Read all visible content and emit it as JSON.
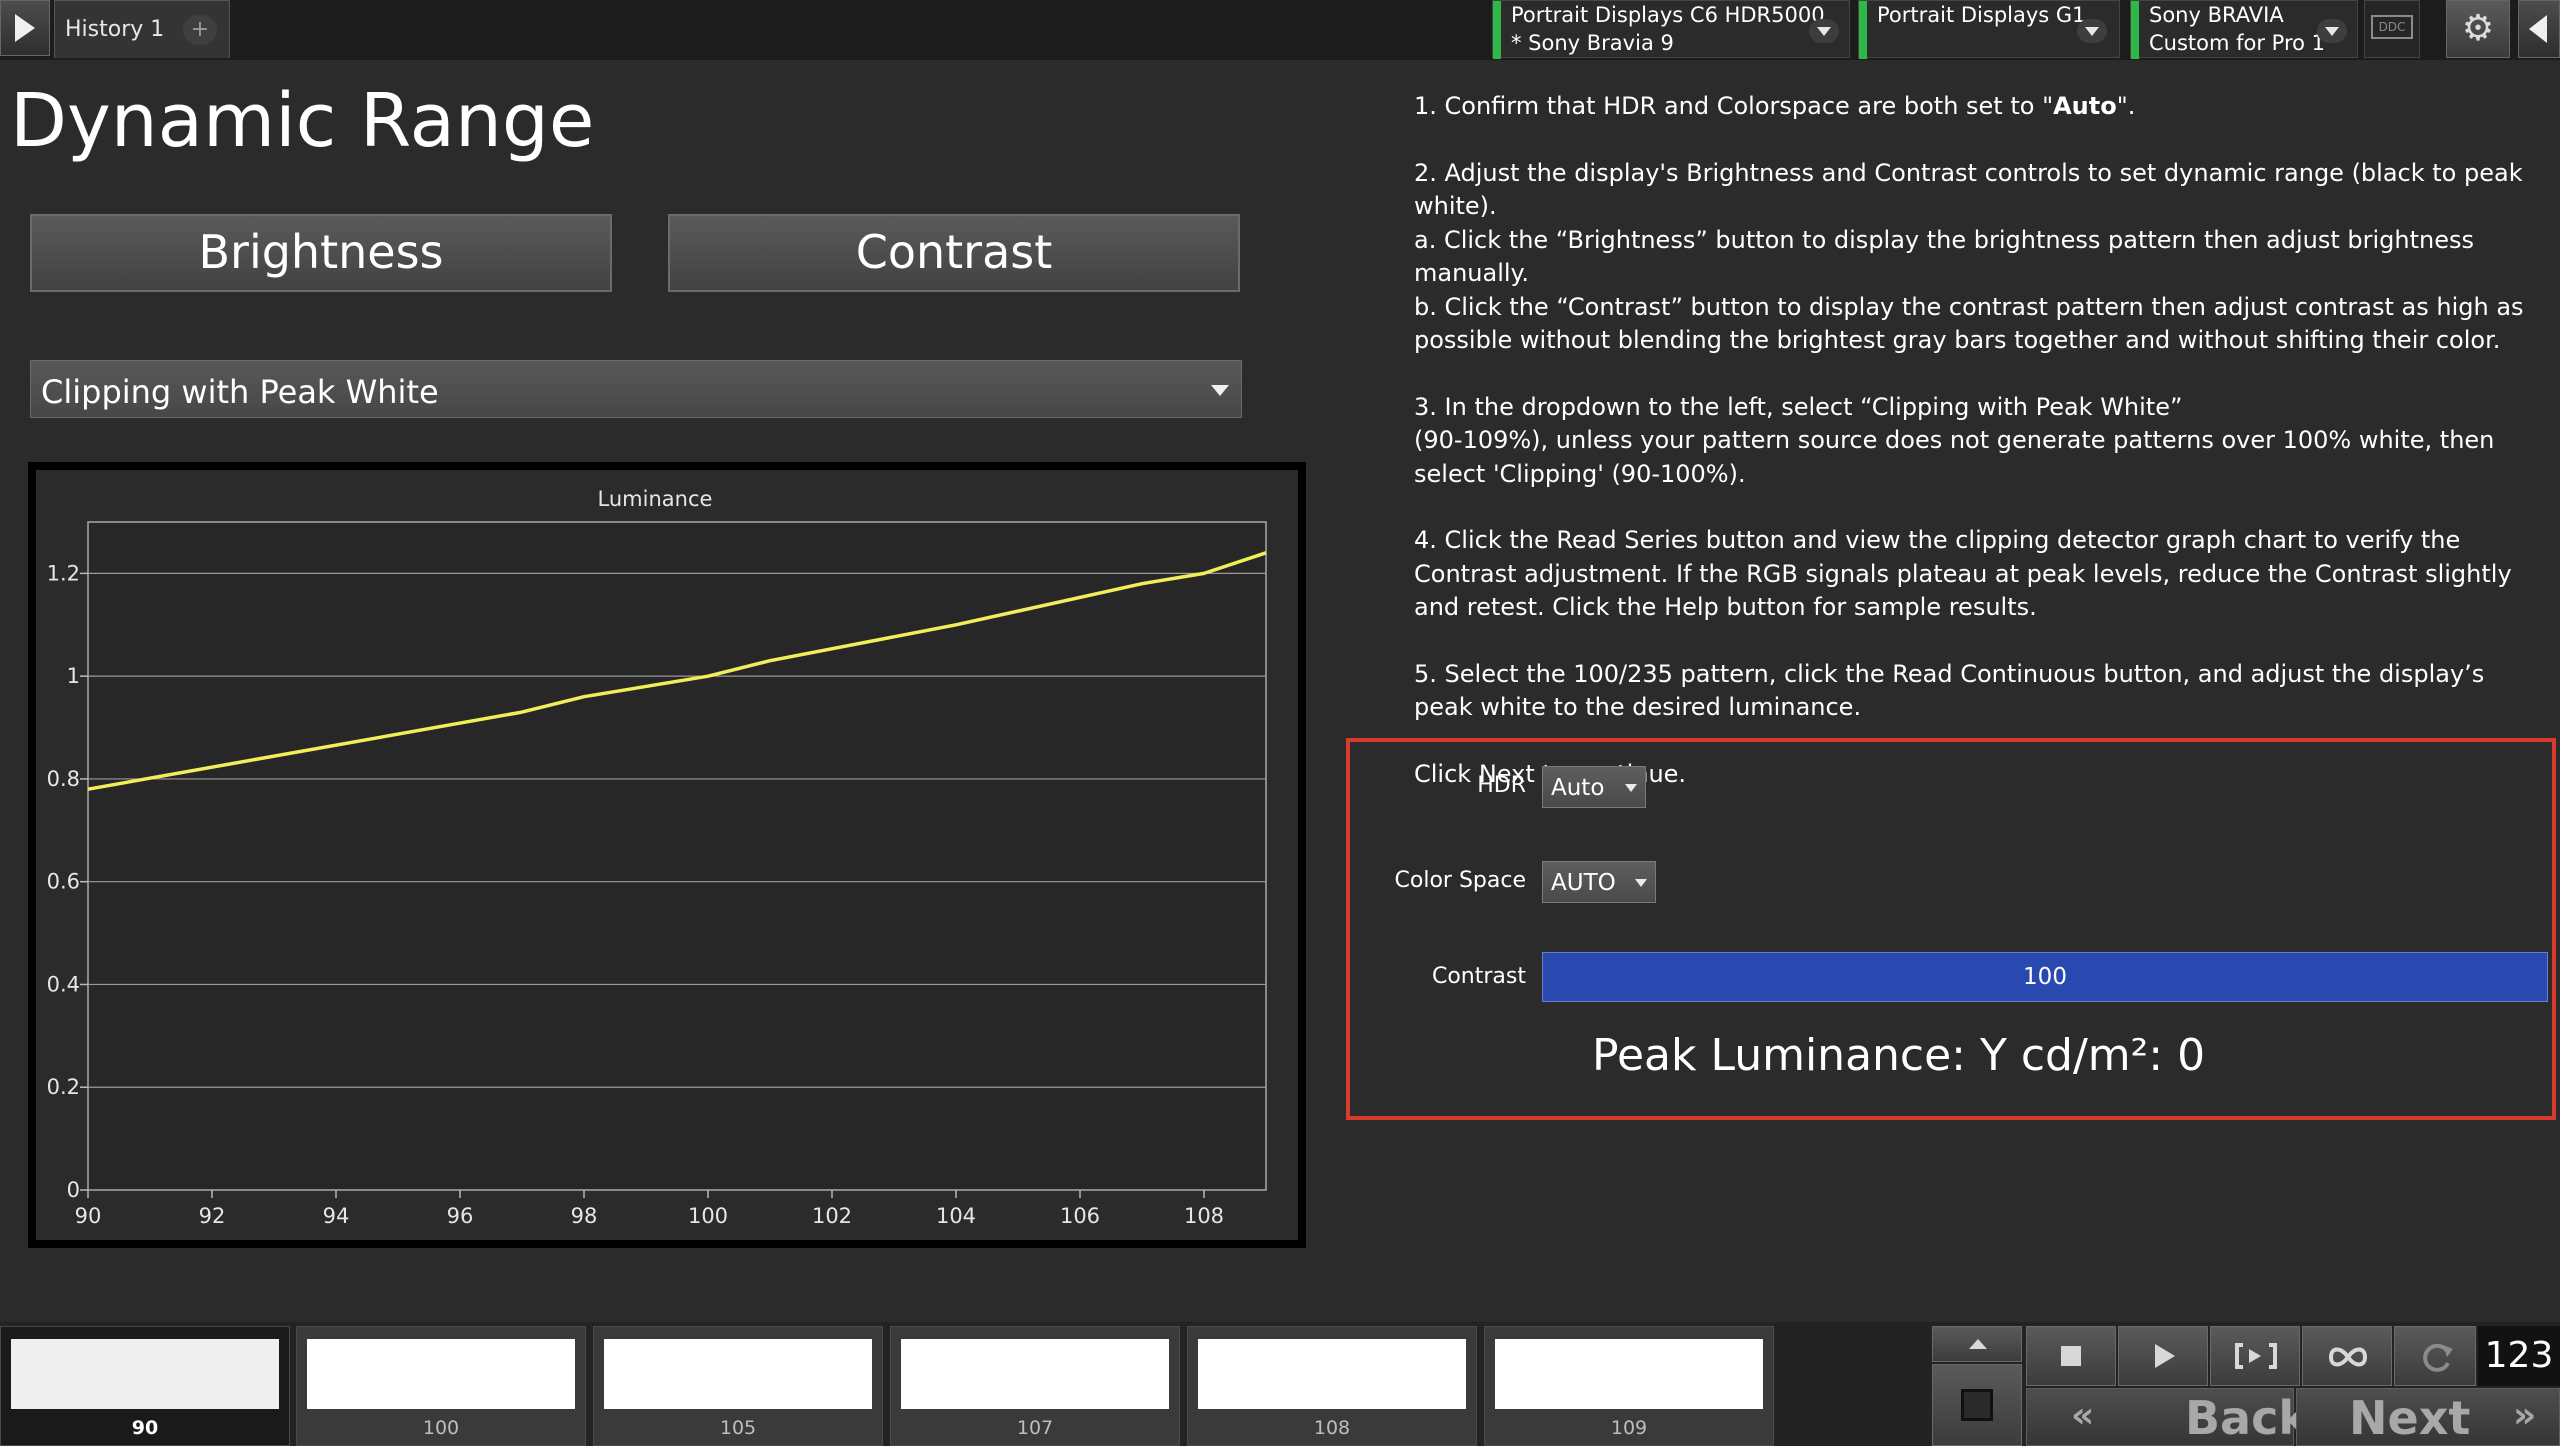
{
  "topbar": {
    "history_tab": "History 1",
    "add_tab": "+",
    "devices": [
      {
        "line1": "Portrait Displays C6 HDR5000",
        "line2": "* Sony Bravia 9"
      },
      {
        "line1": "Portrait Displays G1",
        "line2": ""
      },
      {
        "line1": "Sony BRAVIA",
        "line2": "Custom for Pro 1"
      }
    ],
    "ddc_label": "DDC",
    "status_color": "#2fb84a"
  },
  "page": {
    "title": "Dynamic Range",
    "brightness_label": "Brightness",
    "contrast_label": "Contrast",
    "pattern_selected": "Clipping with Peak White"
  },
  "chart_data": {
    "type": "line",
    "title": "Luminance",
    "xlabel": "",
    "ylabel": "",
    "xlim": [
      90,
      109
    ],
    "ylim": [
      0,
      1.3
    ],
    "x_ticks": [
      90,
      92,
      94,
      96,
      98,
      100,
      102,
      104,
      106,
      108
    ],
    "y_ticks": [
      0,
      0.2,
      0.4,
      0.6,
      0.8,
      1,
      1.2
    ],
    "y_tick_labels": [
      "0",
      "0.2",
      "0.4",
      "0.6",
      "0.8",
      "1",
      "1.2"
    ],
    "grid": true,
    "legend": "none",
    "series": [
      {
        "color": "#f2ee5a",
        "x": [
          90,
          97,
          98,
          100,
          101,
          104,
          107,
          108,
          109
        ],
        "y": [
          0.78,
          0.93,
          0.96,
          1.0,
          1.03,
          1.1,
          1.18,
          1.2,
          1.24
        ]
      }
    ]
  },
  "instructions": {
    "step1_pre": "1.  Confirm that HDR and Colorspace are both set to \"",
    "step1_bold": "Auto",
    "step1_post": "\".",
    "step2": "2. Adjust the display's Brightness and Contrast controls to set dynamic range (black to peak white).",
    "step2a": "a. Click the “Brightness” button to display the brightness pattern then adjust brightness manually.",
    "step2b": "b. Click the “Contrast” button to display the contrast pattern then adjust contrast as high as possible without blending the brightest gray bars together and without shifting their color.",
    "step3a": "3. In the dropdown to the left, select “Clipping with Peak White”",
    "step3b": "(90-109%), unless your pattern source does not generate patterns over 100% white, then select 'Clipping' (90-100%).",
    "step4": "4. Click the Read Series button and view the clipping detector graph chart to verify the Contrast adjustment. If the RGB signals plateau at peak levels, reduce the Contrast slightly and retest. Click the Help button for sample results.",
    "step5": "5. Select the 100/235 pattern, click the Read Continuous button, and adjust the display’s peak white to the desired luminance.",
    "continue": "Click Next to continue."
  },
  "settings": {
    "hdr_label": "HDR",
    "hdr_value": "Auto",
    "colorspace_label": "Color Space",
    "colorspace_value": "AUTO",
    "contrast_label": "Contrast",
    "contrast_value": "100",
    "peak_luminance": "Peak Luminance:  Y cd/m²: 0",
    "highlight_color": "#d93a2e"
  },
  "bottombar": {
    "swatches": [
      "90",
      "100",
      "105",
      "107",
      "108",
      "109"
    ],
    "selected_swatch": "90",
    "counter": "123",
    "back_label": "Back",
    "next_label": "Next"
  }
}
